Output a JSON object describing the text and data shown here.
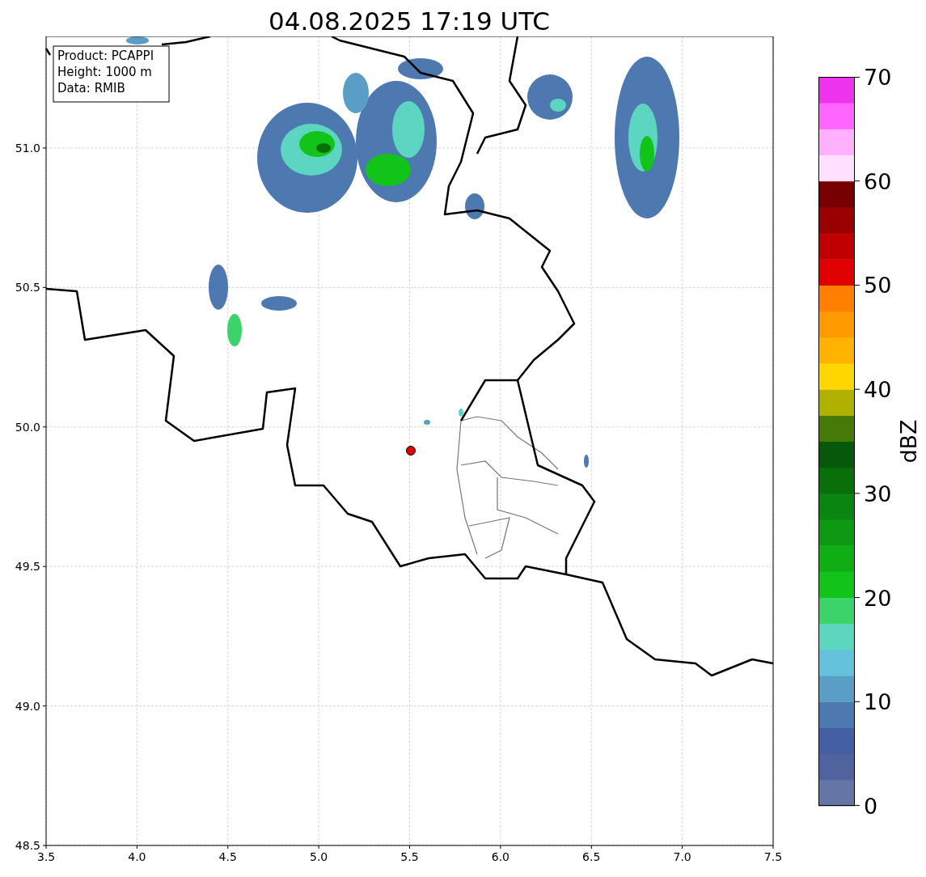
{
  "title": "04.08.2025 17:19 UTC",
  "info_box": {
    "lines": [
      "Product: PCAPPI",
      "Height: 1000 m",
      "Data: RMIB"
    ]
  },
  "x_ticks": [
    "3.5",
    "4.0",
    "4.5",
    "5.0",
    "5.5",
    "6.0",
    "6.5",
    "7.0",
    "7.5"
  ],
  "y_ticks": [
    "51.0",
    "50.5",
    "50.0",
    "49.5",
    "49.0",
    "48.5"
  ],
  "colorbar": {
    "label": "dBZ",
    "ticks": [
      "70",
      "60",
      "50",
      "40",
      "30",
      "20",
      "10",
      "0"
    ]
  }
}
